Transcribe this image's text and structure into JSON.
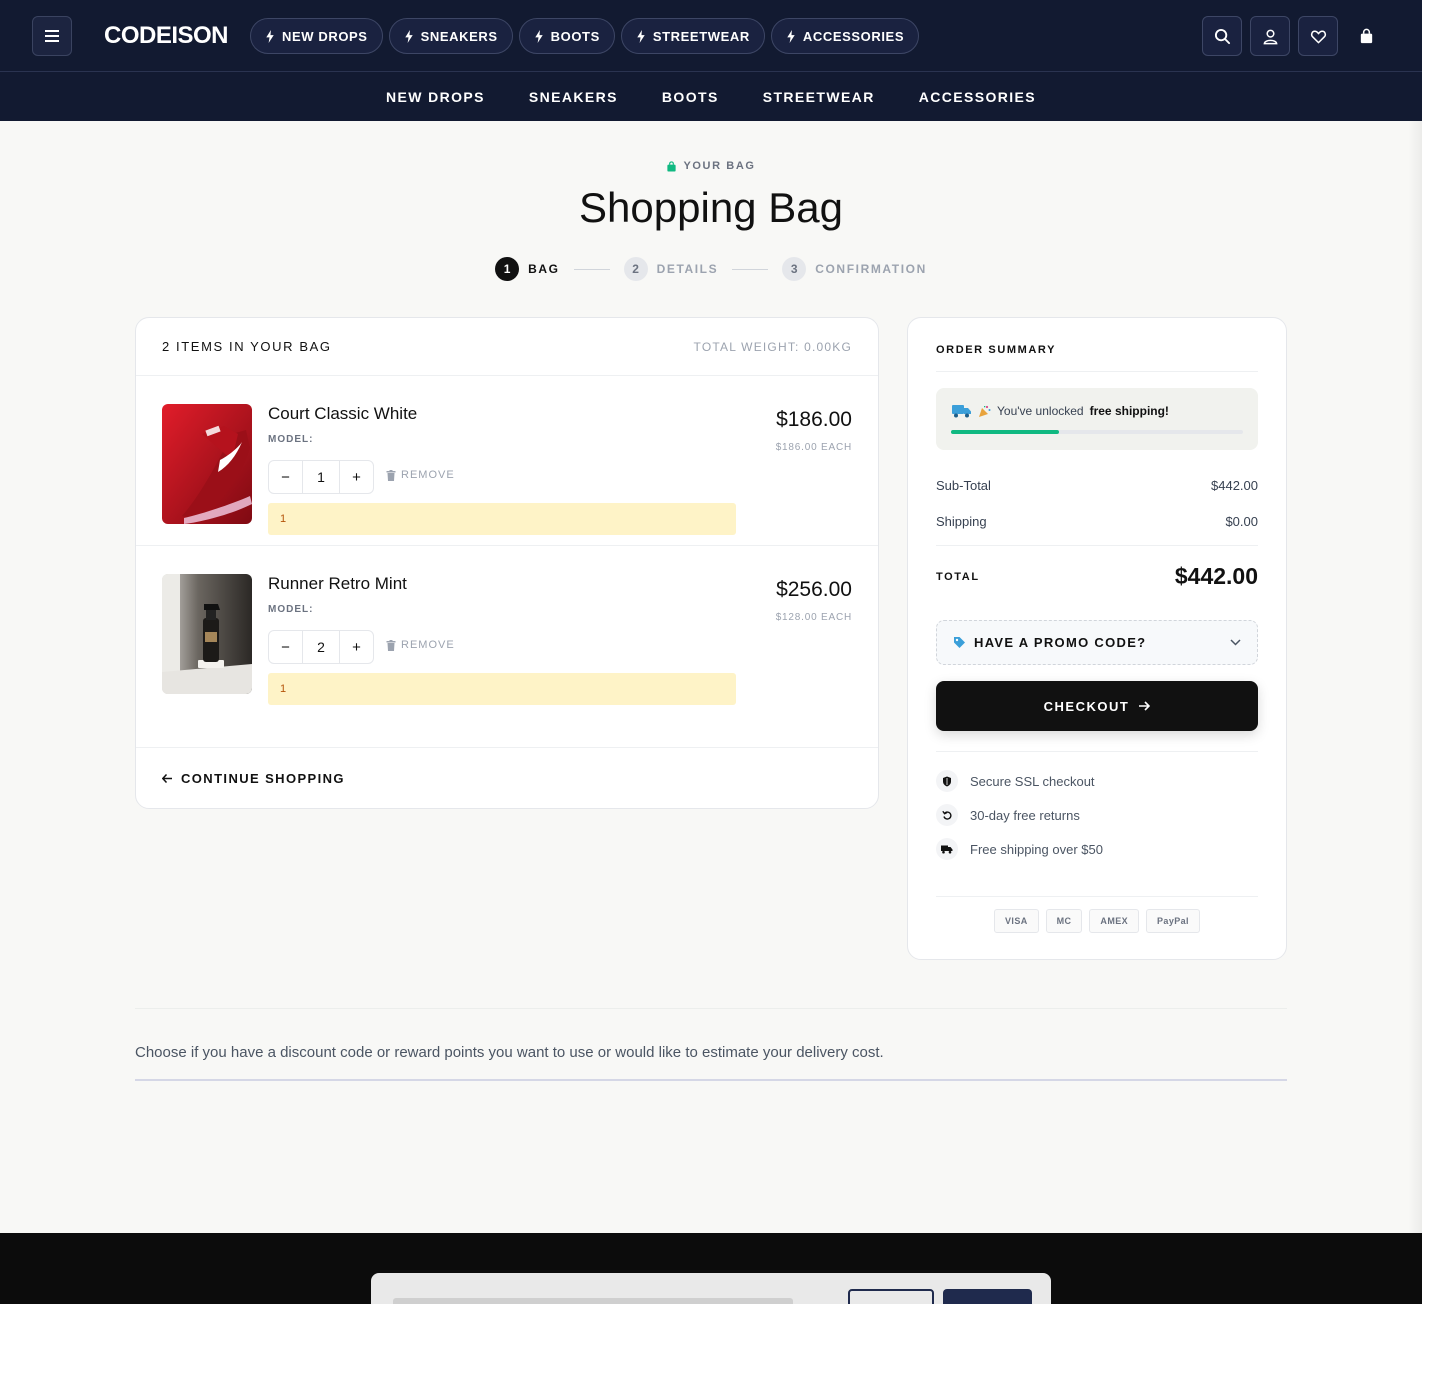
{
  "header": {
    "logo": "CODEISON",
    "pills": [
      {
        "label": "NEW DROPS"
      },
      {
        "label": "SNEAKERS"
      },
      {
        "label": "BOOTS"
      },
      {
        "label": "STREETWEAR"
      },
      {
        "label": "ACCESSORIES"
      }
    ],
    "icons": [
      "search-icon",
      "user-icon",
      "heart-icon",
      "bag-icon"
    ]
  },
  "nav": {
    "items": [
      {
        "label": "NEW DROPS"
      },
      {
        "label": "SNEAKERS"
      },
      {
        "label": "BOOTS"
      },
      {
        "label": "STREETWEAR"
      },
      {
        "label": "ACCESSORIES"
      }
    ]
  },
  "heading": {
    "eyebrow": "YOUR BAG",
    "title": "Shopping Bag"
  },
  "steps": [
    {
      "num": "1",
      "label": "BAG",
      "active": true
    },
    {
      "num": "2",
      "label": "DETAILS",
      "active": false
    },
    {
      "num": "3",
      "label": "CONFIRMATION",
      "active": false
    }
  ],
  "bag": {
    "count_label": "2 ITEMS IN YOUR BAG",
    "weight_label": "TOTAL WEIGHT: 0.00KG",
    "items": [
      {
        "name": "Court Classic White",
        "model_label": "MODEL:",
        "qty": "1",
        "minus": "−",
        "plus": "+",
        "remove_label": "REMOVE",
        "warning": "1",
        "price": "$186.00",
        "each": "$186.00 EACH"
      },
      {
        "name": "Runner Retro Mint",
        "model_label": "MODEL:",
        "qty": "2",
        "minus": "−",
        "plus": "+",
        "remove_label": "REMOVE",
        "warning": "1",
        "price": "$256.00",
        "each": "$128.00 EACH"
      }
    ],
    "continue_label": "CONTINUE SHOPPING"
  },
  "summary": {
    "title": "ORDER SUMMARY",
    "shipping_msg_pre": "You've unlocked ",
    "shipping_msg_bold": "free shipping!",
    "shipping_progress": 0.37,
    "subtotal_label": "Sub-Total",
    "subtotal_value": "$442.00",
    "shipping_label": "Shipping",
    "shipping_value": "$0.00",
    "total_label": "TOTAL",
    "total_value": "$442.00",
    "promo_label": "HAVE A PROMO CODE?",
    "checkout_label": "CHECKOUT",
    "trust": [
      {
        "icon": "shield-icon",
        "label": "Secure SSL checkout"
      },
      {
        "icon": "return-icon",
        "label": "30-day free returns"
      },
      {
        "icon": "truck-icon",
        "label": "Free shipping over $50"
      }
    ],
    "payments": [
      "VISA",
      "MC",
      "AMEX",
      "PayPal"
    ]
  },
  "lower": {
    "text": "Choose if you have a discount code or reward points you want to use or would like to estimate your delivery cost."
  },
  "colors": {
    "header_bg": "#121a31",
    "accent_green": "#10b981",
    "warning_bg": "#fef3c7",
    "checkout_bg": "#111111"
  }
}
